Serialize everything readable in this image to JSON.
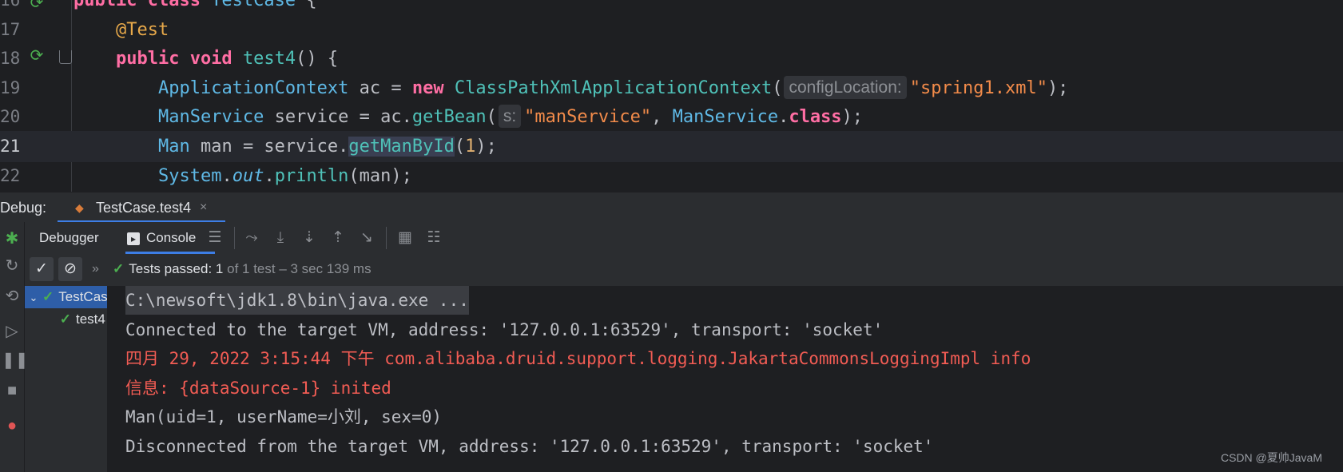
{
  "editor": {
    "lines": [
      {
        "num": "16",
        "tokens": [
          {
            "t": "public class ",
            "c": "kw"
          },
          {
            "t": "TestCase",
            "c": "type"
          },
          {
            "t": " {",
            "c": ""
          }
        ]
      },
      {
        "num": "17",
        "tokens": [
          {
            "t": "    ",
            "c": ""
          },
          {
            "t": "@Test",
            "c": "ann"
          }
        ]
      },
      {
        "num": "18",
        "tokens": [
          {
            "t": "    ",
            "c": ""
          },
          {
            "t": "public void ",
            "c": "kw"
          },
          {
            "t": "test4",
            "c": "fn"
          },
          {
            "t": "() {",
            "c": ""
          }
        ]
      },
      {
        "num": "19",
        "tokens": [
          {
            "t": "        ",
            "c": ""
          },
          {
            "t": "ApplicationContext",
            "c": "type"
          },
          {
            "t": " ac = ",
            "c": ""
          },
          {
            "t": "new ",
            "c": "kw"
          },
          {
            "t": "ClassPathXmlApplicationContext",
            "c": "fn"
          },
          {
            "t": "(",
            "c": ""
          },
          {
            "t": "configLocation:",
            "c": "hint"
          },
          {
            "t": "\"spring1.xml\"",
            "c": "str"
          },
          {
            "t": ");",
            "c": ""
          }
        ]
      },
      {
        "num": "20",
        "tokens": [
          {
            "t": "        ",
            "c": ""
          },
          {
            "t": "ManService",
            "c": "type"
          },
          {
            "t": " service = ac.",
            "c": ""
          },
          {
            "t": "getBean",
            "c": "fn"
          },
          {
            "t": "(",
            "c": ""
          },
          {
            "t": "s:",
            "c": "hint"
          },
          {
            "t": "\"manService\"",
            "c": "str"
          },
          {
            "t": ", ",
            "c": ""
          },
          {
            "t": "ManService",
            "c": "type"
          },
          {
            "t": ".",
            "c": ""
          },
          {
            "t": "class",
            "c": "kw"
          },
          {
            "t": ");",
            "c": ""
          }
        ]
      },
      {
        "num": "21",
        "tokens": [
          {
            "t": "        ",
            "c": ""
          },
          {
            "t": "Man",
            "c": "type"
          },
          {
            "t": " man = service.",
            "c": ""
          },
          {
            "t": "getManById",
            "c": "fn hl"
          },
          {
            "t": "(",
            "c": ""
          },
          {
            "t": "1",
            "c": "num"
          },
          {
            "t": ");",
            "c": ""
          }
        ]
      },
      {
        "num": "22",
        "tokens": [
          {
            "t": "        ",
            "c": ""
          },
          {
            "t": "System",
            "c": "type"
          },
          {
            "t": ".",
            "c": ""
          },
          {
            "t": "out",
            "c": "ital"
          },
          {
            "t": ".",
            "c": ""
          },
          {
            "t": "println",
            "c": "fn"
          },
          {
            "t": "(man);",
            "c": ""
          }
        ]
      }
    ]
  },
  "debug": {
    "label": "Debug:",
    "run_tab": "TestCase.test4",
    "tabs": {
      "debugger": "Debugger",
      "console": "Console"
    },
    "status": {
      "prefix": "Tests passed: ",
      "count": "1",
      "of": " of 1 test",
      "duration": " – 3 sec 139 ms"
    },
    "tree": [
      {
        "label": "TestCase",
        "selected": true,
        "indent": 0
      },
      {
        "label": "test4",
        "selected": false,
        "indent": 1
      }
    ]
  },
  "console": {
    "lines": [
      {
        "text": "C:\\newsoft\\jdk1.8\\bin\\java.exe ...",
        "style": "cmd"
      },
      {
        "text": "Connected to the target VM, address: '127.0.0.1:63529', transport: 'socket'",
        "style": "normal"
      },
      {
        "text": "四月 29, 2022 3:15:44 下午 com.alibaba.druid.support.logging.JakartaCommonsLoggingImpl info",
        "style": "err"
      },
      {
        "text": "信息: {dataSource-1} inited",
        "style": "err"
      },
      {
        "text": "Man(uid=1, userName=小刘, sex=0)",
        "style": "normal"
      },
      {
        "text": "Disconnected from the target VM, address: '127.0.0.1:63529', transport: 'socket'",
        "style": "normal"
      }
    ]
  },
  "watermark": "CSDN @夏帅JavaM",
  "colors": {
    "accent": "#3d7ee6",
    "pass": "#4caf50",
    "error": "#f25c54"
  }
}
